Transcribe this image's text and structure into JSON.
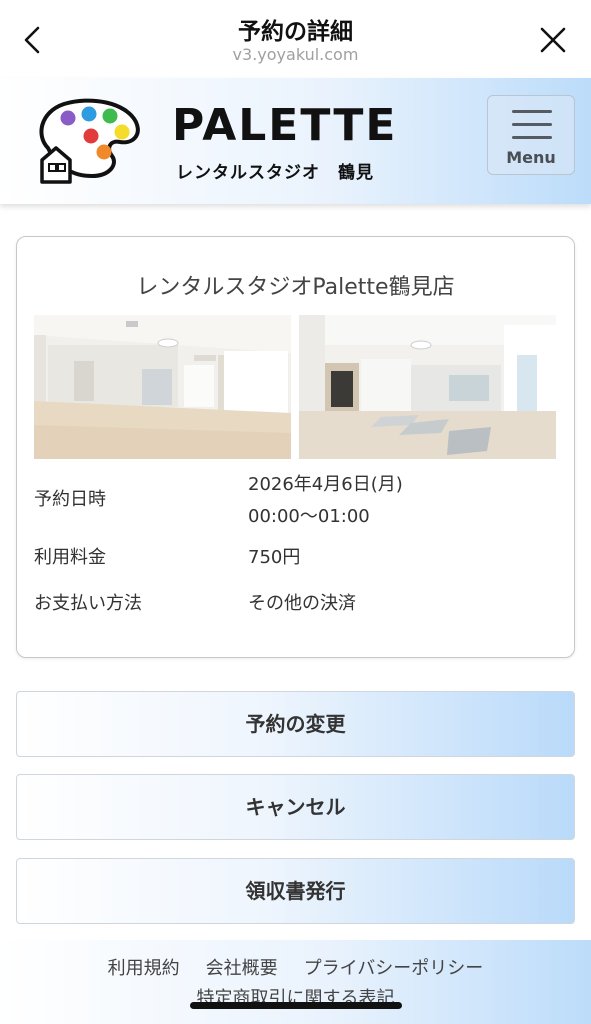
{
  "browser": {
    "title": "予約の詳細",
    "url": "v3.yoyakul.com"
  },
  "header": {
    "brand_name": "PALETTE",
    "brand_sub": "レンタルスタジオ",
    "brand_branch": "鶴見",
    "menu_label": "Menu"
  },
  "reservation": {
    "store_name": "レンタルスタジオPalette鶴見店",
    "date_label": "予約日時",
    "date_value": "2026年4月6日(月)",
    "time_value": "00:00〜01:00",
    "fee_label": "利用料金",
    "fee_value": "750円",
    "payment_label": "お支払い方法",
    "payment_value": "その他の決済"
  },
  "actions": {
    "change_label": "予約の変更",
    "cancel_label": "キャンセル",
    "receipt_label": "領収書発行"
  },
  "footer": {
    "terms": "利用規約",
    "company": "会社概要",
    "privacy": "プライバシーポリシー",
    "commerce": "特定商取引に関する表記"
  },
  "colors": {
    "accent_light_blue": "#bcdcfa",
    "border_gray": "#c8c8c8",
    "text_dark": "#333333"
  }
}
